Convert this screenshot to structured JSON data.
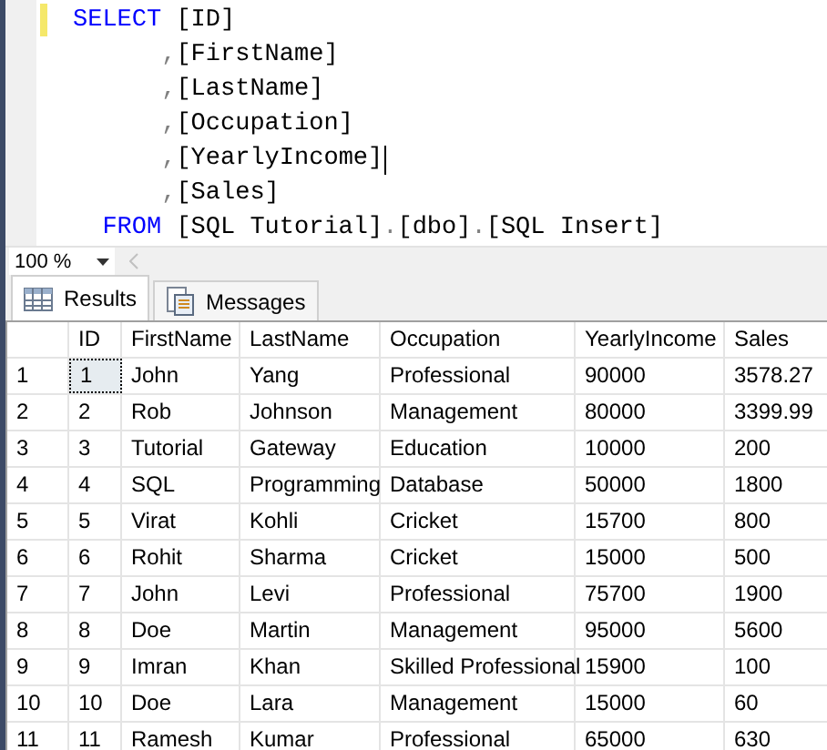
{
  "editor": {
    "lines": [
      {
        "kind": "select",
        "caret": false,
        "tokens": [
          {
            "kind": "keyword",
            "text": "SELECT"
          },
          {
            "kind": "plain",
            "text": " [ID]"
          }
        ]
      },
      {
        "kind": "column",
        "caret": false,
        "tokens": [
          {
            "kind": "punct",
            "text": ","
          },
          {
            "kind": "plain",
            "text": "[FirstName]"
          }
        ]
      },
      {
        "kind": "column",
        "caret": false,
        "tokens": [
          {
            "kind": "punct",
            "text": ","
          },
          {
            "kind": "plain",
            "text": "[LastName]"
          }
        ]
      },
      {
        "kind": "column",
        "caret": false,
        "tokens": [
          {
            "kind": "punct",
            "text": ","
          },
          {
            "kind": "plain",
            "text": "[Occupation]"
          }
        ]
      },
      {
        "kind": "column",
        "caret": true,
        "tokens": [
          {
            "kind": "punct",
            "text": ","
          },
          {
            "kind": "plain",
            "text": "[YearlyIncome]"
          }
        ]
      },
      {
        "kind": "column",
        "caret": false,
        "tokens": [
          {
            "kind": "punct",
            "text": ","
          },
          {
            "kind": "plain",
            "text": "[Sales]"
          }
        ]
      },
      {
        "kind": "from",
        "caret": false,
        "tokens": [
          {
            "kind": "keyword",
            "text": "FROM"
          },
          {
            "kind": "plain",
            "text": " [SQL Tutorial]"
          },
          {
            "kind": "punct",
            "text": "."
          },
          {
            "kind": "plain",
            "text": "[dbo]"
          },
          {
            "kind": "punct",
            "text": "."
          },
          {
            "kind": "plain",
            "text": "[SQL Insert]"
          }
        ]
      }
    ]
  },
  "zoom": {
    "value": "100 %"
  },
  "tabs": [
    {
      "label": "Results",
      "selected": true
    },
    {
      "label": "Messages",
      "selected": false
    }
  ],
  "grid": {
    "columns": [
      "ID",
      "FirstName",
      "LastName",
      "Occupation",
      "YearlyIncome",
      "Sales"
    ],
    "rows": [
      {
        "number": "1",
        "focused": true,
        "cells": [
          "1",
          "John",
          "Yang",
          "Professional",
          "90000",
          "3578.27"
        ]
      },
      {
        "number": "2",
        "focused": false,
        "cells": [
          "2",
          "Rob",
          "Johnson",
          "Management",
          "80000",
          "3399.99"
        ]
      },
      {
        "number": "3",
        "focused": false,
        "cells": [
          "3",
          "Tutorial",
          "Gateway",
          "Education",
          "10000",
          "200"
        ]
      },
      {
        "number": "4",
        "focused": false,
        "cells": [
          "4",
          "SQL",
          "Programming",
          "Database",
          "50000",
          "1800"
        ]
      },
      {
        "number": "5",
        "focused": false,
        "cells": [
          "5",
          "Virat",
          "Kohli",
          "Cricket",
          "15700",
          "800"
        ]
      },
      {
        "number": "6",
        "focused": false,
        "cells": [
          "6",
          "Rohit",
          "Sharma",
          "Cricket",
          "15000",
          "500"
        ]
      },
      {
        "number": "7",
        "focused": false,
        "cells": [
          "7",
          "John",
          "Levi",
          "Professional",
          "75700",
          "1900"
        ]
      },
      {
        "number": "8",
        "focused": false,
        "cells": [
          "8",
          "Doe",
          "Martin",
          "Management",
          "95000",
          "5600"
        ]
      },
      {
        "number": "9",
        "focused": false,
        "cells": [
          "9",
          "Imran",
          "Khan",
          "Skilled Professional",
          "15900",
          "100"
        ]
      },
      {
        "number": "10",
        "focused": false,
        "cells": [
          "10",
          "Doe",
          "Lara",
          "Management",
          "15000",
          "60"
        ]
      },
      {
        "number": "11",
        "focused": false,
        "cells": [
          "11",
          "Ramesh",
          "Kumar",
          "Professional",
          "65000",
          "630"
        ]
      }
    ]
  }
}
